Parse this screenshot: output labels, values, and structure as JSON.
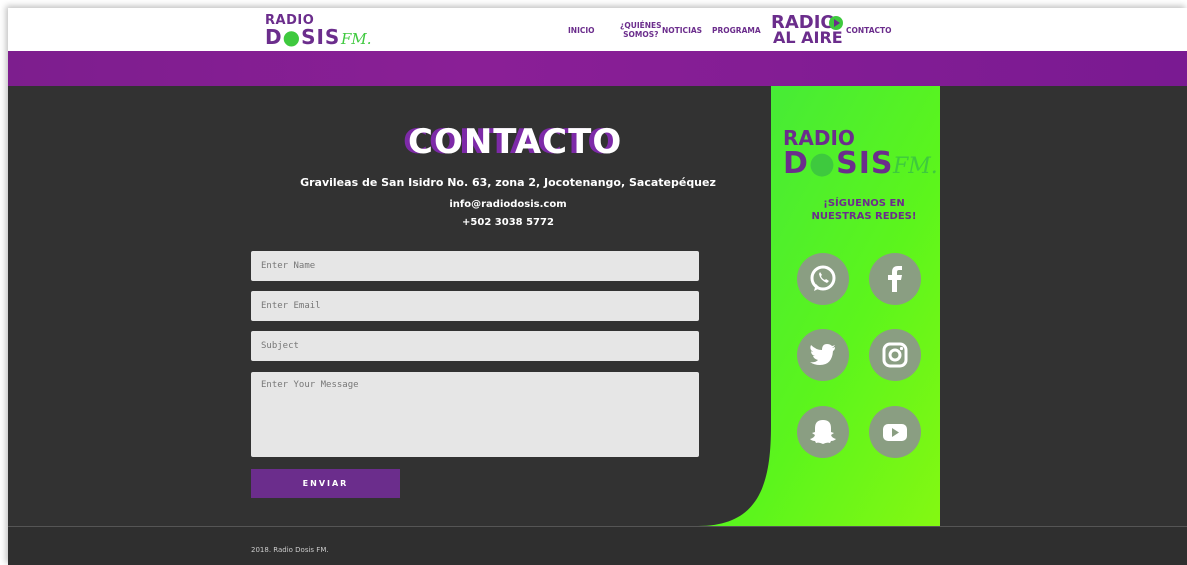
{
  "header": {
    "logo": {
      "line1": "RADIO",
      "line2a": "D",
      "line2b": "SIS",
      "line2c": "FM."
    },
    "nav": [
      {
        "label": "INICIO"
      },
      {
        "label_l1": "¿QUIÉNES",
        "label_l2": "SOMOS?"
      },
      {
        "label": "NOTICIAS"
      },
      {
        "label": "PROGRAMA"
      },
      {
        "label_l1": "RADIO",
        "label_l2": "AL AIRE"
      },
      {
        "label": "CONTACTO"
      }
    ]
  },
  "contact": {
    "title": "CONTACTO",
    "address": "Gravileas de San Isidro No. 63, zona 2, Jocotenango, Sacatepéquez",
    "email": "info@radiodosis.com",
    "phone": "+502 3038 5772",
    "form": {
      "name_placeholder": "Enter Name",
      "email_placeholder": "Enter Email",
      "subject_placeholder": "Subject",
      "message_placeholder": "Enter Your Message",
      "submit_label": "ENVIAR"
    }
  },
  "sidebar": {
    "logo": {
      "line1": "RADIO",
      "line2a": "D",
      "line2b": "SIS",
      "line2c": "FM."
    },
    "follow_l1": "¡SÍGUENOS EN",
    "follow_l2": "NUESTRAS REDES!",
    "socials": [
      "whatsapp-icon",
      "facebook-icon",
      "twitter-icon",
      "instagram-icon",
      "snapchat-icon",
      "youtube-icon"
    ]
  },
  "footer": {
    "copyright": "2018. Radio Dosis FM."
  },
  "colors": {
    "purple": "#6b2d8c",
    "green": "#3ee83e",
    "dark": "#323232"
  }
}
